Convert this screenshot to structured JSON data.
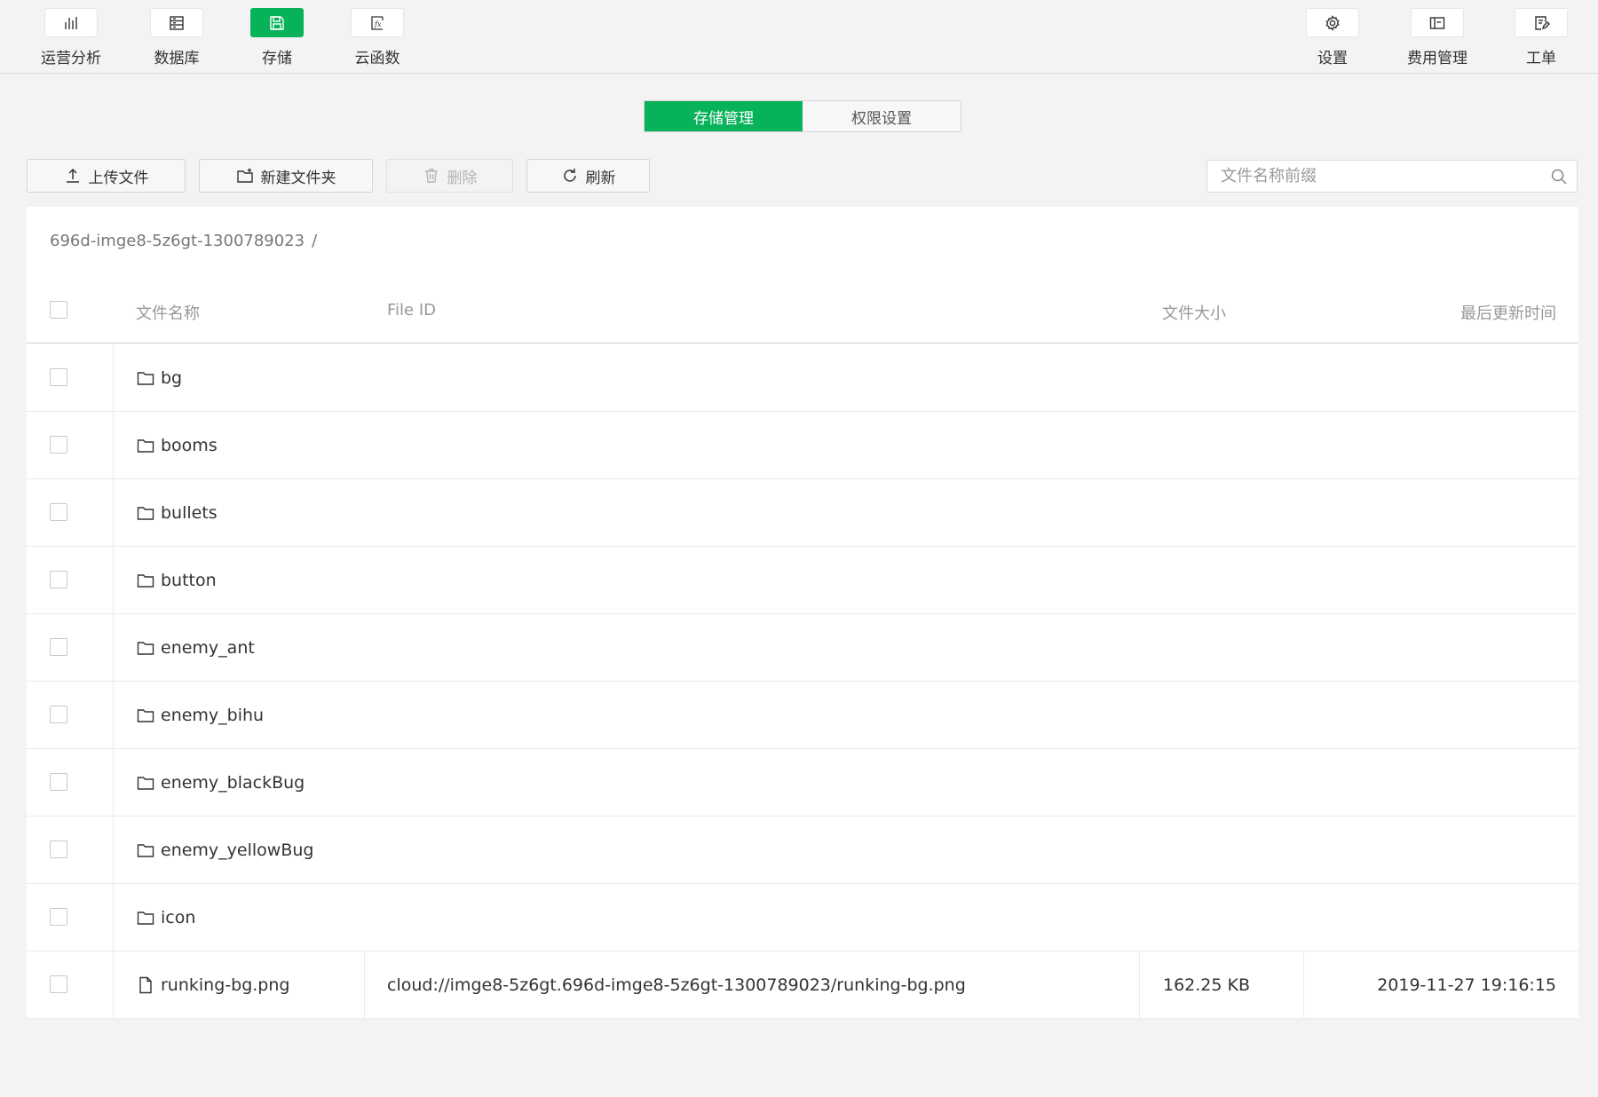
{
  "nav": {
    "left": [
      {
        "label": "运营分析",
        "icon": "bar-chart-icon"
      },
      {
        "label": "数据库",
        "icon": "database-icon"
      },
      {
        "label": "存储",
        "icon": "save-icon",
        "active": true
      },
      {
        "label": "云函数",
        "icon": "function-icon"
      }
    ],
    "right": [
      {
        "label": "设置",
        "icon": "gear-icon"
      },
      {
        "label": "费用管理",
        "icon": "billing-icon"
      },
      {
        "label": "工单",
        "icon": "ticket-icon"
      }
    ]
  },
  "tabs": [
    {
      "label": "存储管理",
      "active": true
    },
    {
      "label": "权限设置",
      "active": false
    }
  ],
  "toolbar": {
    "upload": "上传文件",
    "new_folder": "新建文件夹",
    "delete": "删除",
    "refresh": "刷新"
  },
  "search": {
    "placeholder": "文件名称前缀",
    "value": ""
  },
  "breadcrumb": {
    "bucket": "696d-imge8-5z6gt-1300789023",
    "separator": "/"
  },
  "table": {
    "headers": {
      "name": "文件名称",
      "file_id": "File ID",
      "size": "文件大小",
      "updated": "最后更新时间"
    },
    "rows": [
      {
        "type": "folder",
        "name": "bg"
      },
      {
        "type": "folder",
        "name": "booms"
      },
      {
        "type": "folder",
        "name": "bullets"
      },
      {
        "type": "folder",
        "name": "button"
      },
      {
        "type": "folder",
        "name": "enemy_ant"
      },
      {
        "type": "folder",
        "name": "enemy_bihu"
      },
      {
        "type": "folder",
        "name": "enemy_blackBug"
      },
      {
        "type": "folder",
        "name": "enemy_yellowBug"
      },
      {
        "type": "folder",
        "name": "icon"
      },
      {
        "type": "file",
        "name": "runking-bg.png",
        "file_id": "cloud://imge8-5z6gt.696d-imge8-5z6gt-1300789023/runking-bg.png",
        "size": "162.25 KB",
        "updated": "2019-11-27 19:16:15"
      }
    ]
  },
  "colors": {
    "accent": "#07b25b",
    "background": "#f3f3f3"
  }
}
